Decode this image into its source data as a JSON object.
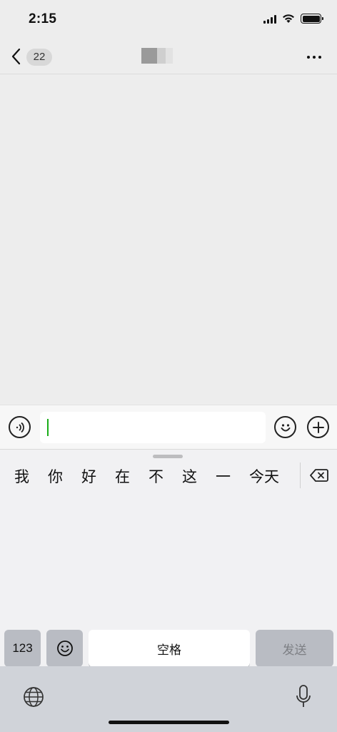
{
  "status_bar": {
    "time": "2:15",
    "icons": [
      "signal-icon",
      "wifi-icon",
      "battery-icon"
    ]
  },
  "nav_bar": {
    "back_icon": "chevron-left-icon",
    "unread_count": "22",
    "title_icon": "pixelated-contact-name",
    "more_icon": "more-dots-icon"
  },
  "input_bar": {
    "voice_icon": "voice-icon",
    "text_value": "",
    "emoji_icon": "emoji-icon",
    "plus_icon": "plus-icon"
  },
  "keyboard": {
    "candidates": [
      "我",
      "你",
      "好",
      "在",
      "不",
      "这",
      "一",
      "今天"
    ],
    "delete_icon": "backspace-icon",
    "keys": {
      "numbers": "123",
      "emoji_icon": "emoji-icon",
      "space": "空格",
      "send": "发送"
    },
    "bottom": {
      "globe_icon": "globe-icon",
      "mic_icon": "microphone-icon"
    }
  },
  "colors": {
    "background": "#ededed",
    "caret": "#1aad19",
    "keyboard": "#f1f1f3",
    "key_gray": "#b9bcc3"
  }
}
